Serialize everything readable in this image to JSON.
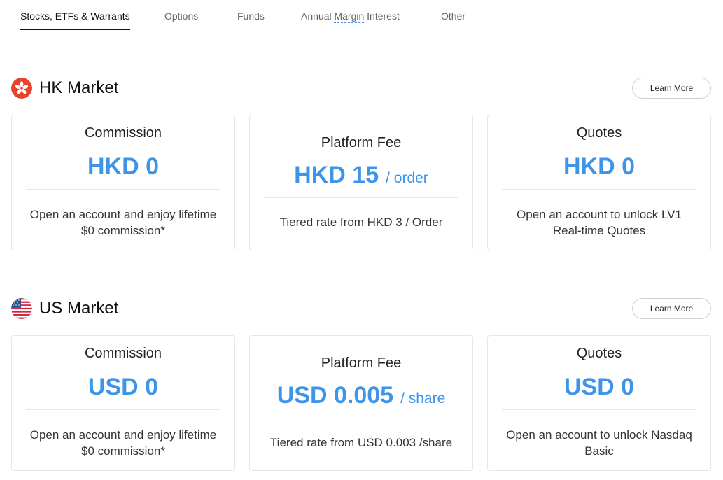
{
  "tabs": [
    {
      "label": "Stocks, ETFs & Warrants",
      "active": true
    },
    {
      "label": "Options"
    },
    {
      "label": "Funds"
    },
    {
      "label_before": "Annual ",
      "label_underlined": "Margin",
      "label_after": " Interest"
    },
    {
      "label": "Other"
    }
  ],
  "markets": [
    {
      "title": "HK Market",
      "learn_more": "Learn More",
      "cards": [
        {
          "title": "Commission",
          "value": "HKD 0",
          "desc": "Open an account and enjoy lifetime $0 commission*"
        },
        {
          "title": "Platform Fee",
          "value": "HKD 15",
          "unit": "/ order",
          "desc": "Tiered rate from HKD 3 / Order"
        },
        {
          "title": "Quotes",
          "value": "HKD 0",
          "desc": "Open an account to unlock LV1 Real-time Quotes"
        }
      ]
    },
    {
      "title": "US Market",
      "learn_more": "Learn More",
      "cards": [
        {
          "title": "Commission",
          "value": "USD 0",
          "desc": "Open an account and enjoy lifetime $0 commission*"
        },
        {
          "title": "Platform Fee",
          "value": "USD 0.005",
          "unit": "/ share",
          "desc": "Tiered rate from USD 0.003 /share"
        },
        {
          "title": "Quotes",
          "value": "USD 0",
          "desc": "Open an account to unlock Nasdaq Basic"
        }
      ]
    }
  ],
  "colors": {
    "accent": "#3d94e8",
    "hk_flag": "#e8432e",
    "us_flag_red": "#d7263d",
    "us_flag_blue": "#2a4d8f"
  },
  "icons": {
    "hk": "hk-flag-icon",
    "us": "us-flag-icon"
  }
}
